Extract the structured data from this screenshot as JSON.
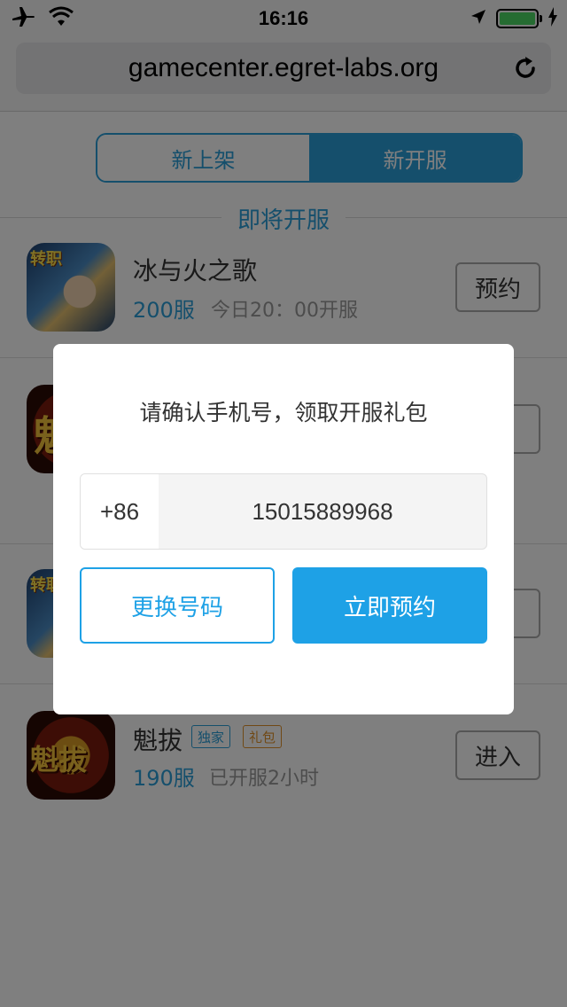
{
  "status_bar": {
    "time": "16:16",
    "icons": [
      "airplane-icon",
      "wifi-icon",
      "location-arrow-icon",
      "battery-icon",
      "charging-bolt-icon"
    ]
  },
  "browser": {
    "url": "gamecenter.egret-labs.org",
    "reload_icon": "reload-icon"
  },
  "tabs": [
    {
      "label": "新上架",
      "active": false
    },
    {
      "label": "新开服",
      "active": true
    }
  ],
  "section": {
    "title": "即将开服"
  },
  "games": [
    {
      "name": "冰与火之歌",
      "server": "200服",
      "time": "今日20：00开服",
      "action": "预约",
      "icon_badge": "转职",
      "icon": "game-icon-blond-hero"
    },
    {
      "name": "",
      "server": "",
      "time": "",
      "action": "",
      "icon_char": "魁",
      "icon": "game-icon-kuiba"
    },
    {
      "name": "",
      "server": "",
      "time": "",
      "action": "",
      "icon_badge": "转职",
      "icon": "game-icon-blond-hero"
    },
    {
      "name": "魁拔",
      "tags": [
        "独家",
        "礼包"
      ],
      "server": "190服",
      "time": "已开服2小时",
      "action": "进入",
      "icon_char": "魁拔",
      "icon": "game-icon-kuiba"
    }
  ],
  "modal": {
    "title": "请确认手机号，领取开服礼包",
    "country_code": "+86",
    "phone": "15015889968",
    "change_label": "更换号码",
    "reserve_label": "立即预约"
  },
  "colors": {
    "accent": "#1ea1e6",
    "tag_exclusive": "#2a9ed8",
    "tag_gift": "#e0922a",
    "battery": "#4cd964"
  }
}
